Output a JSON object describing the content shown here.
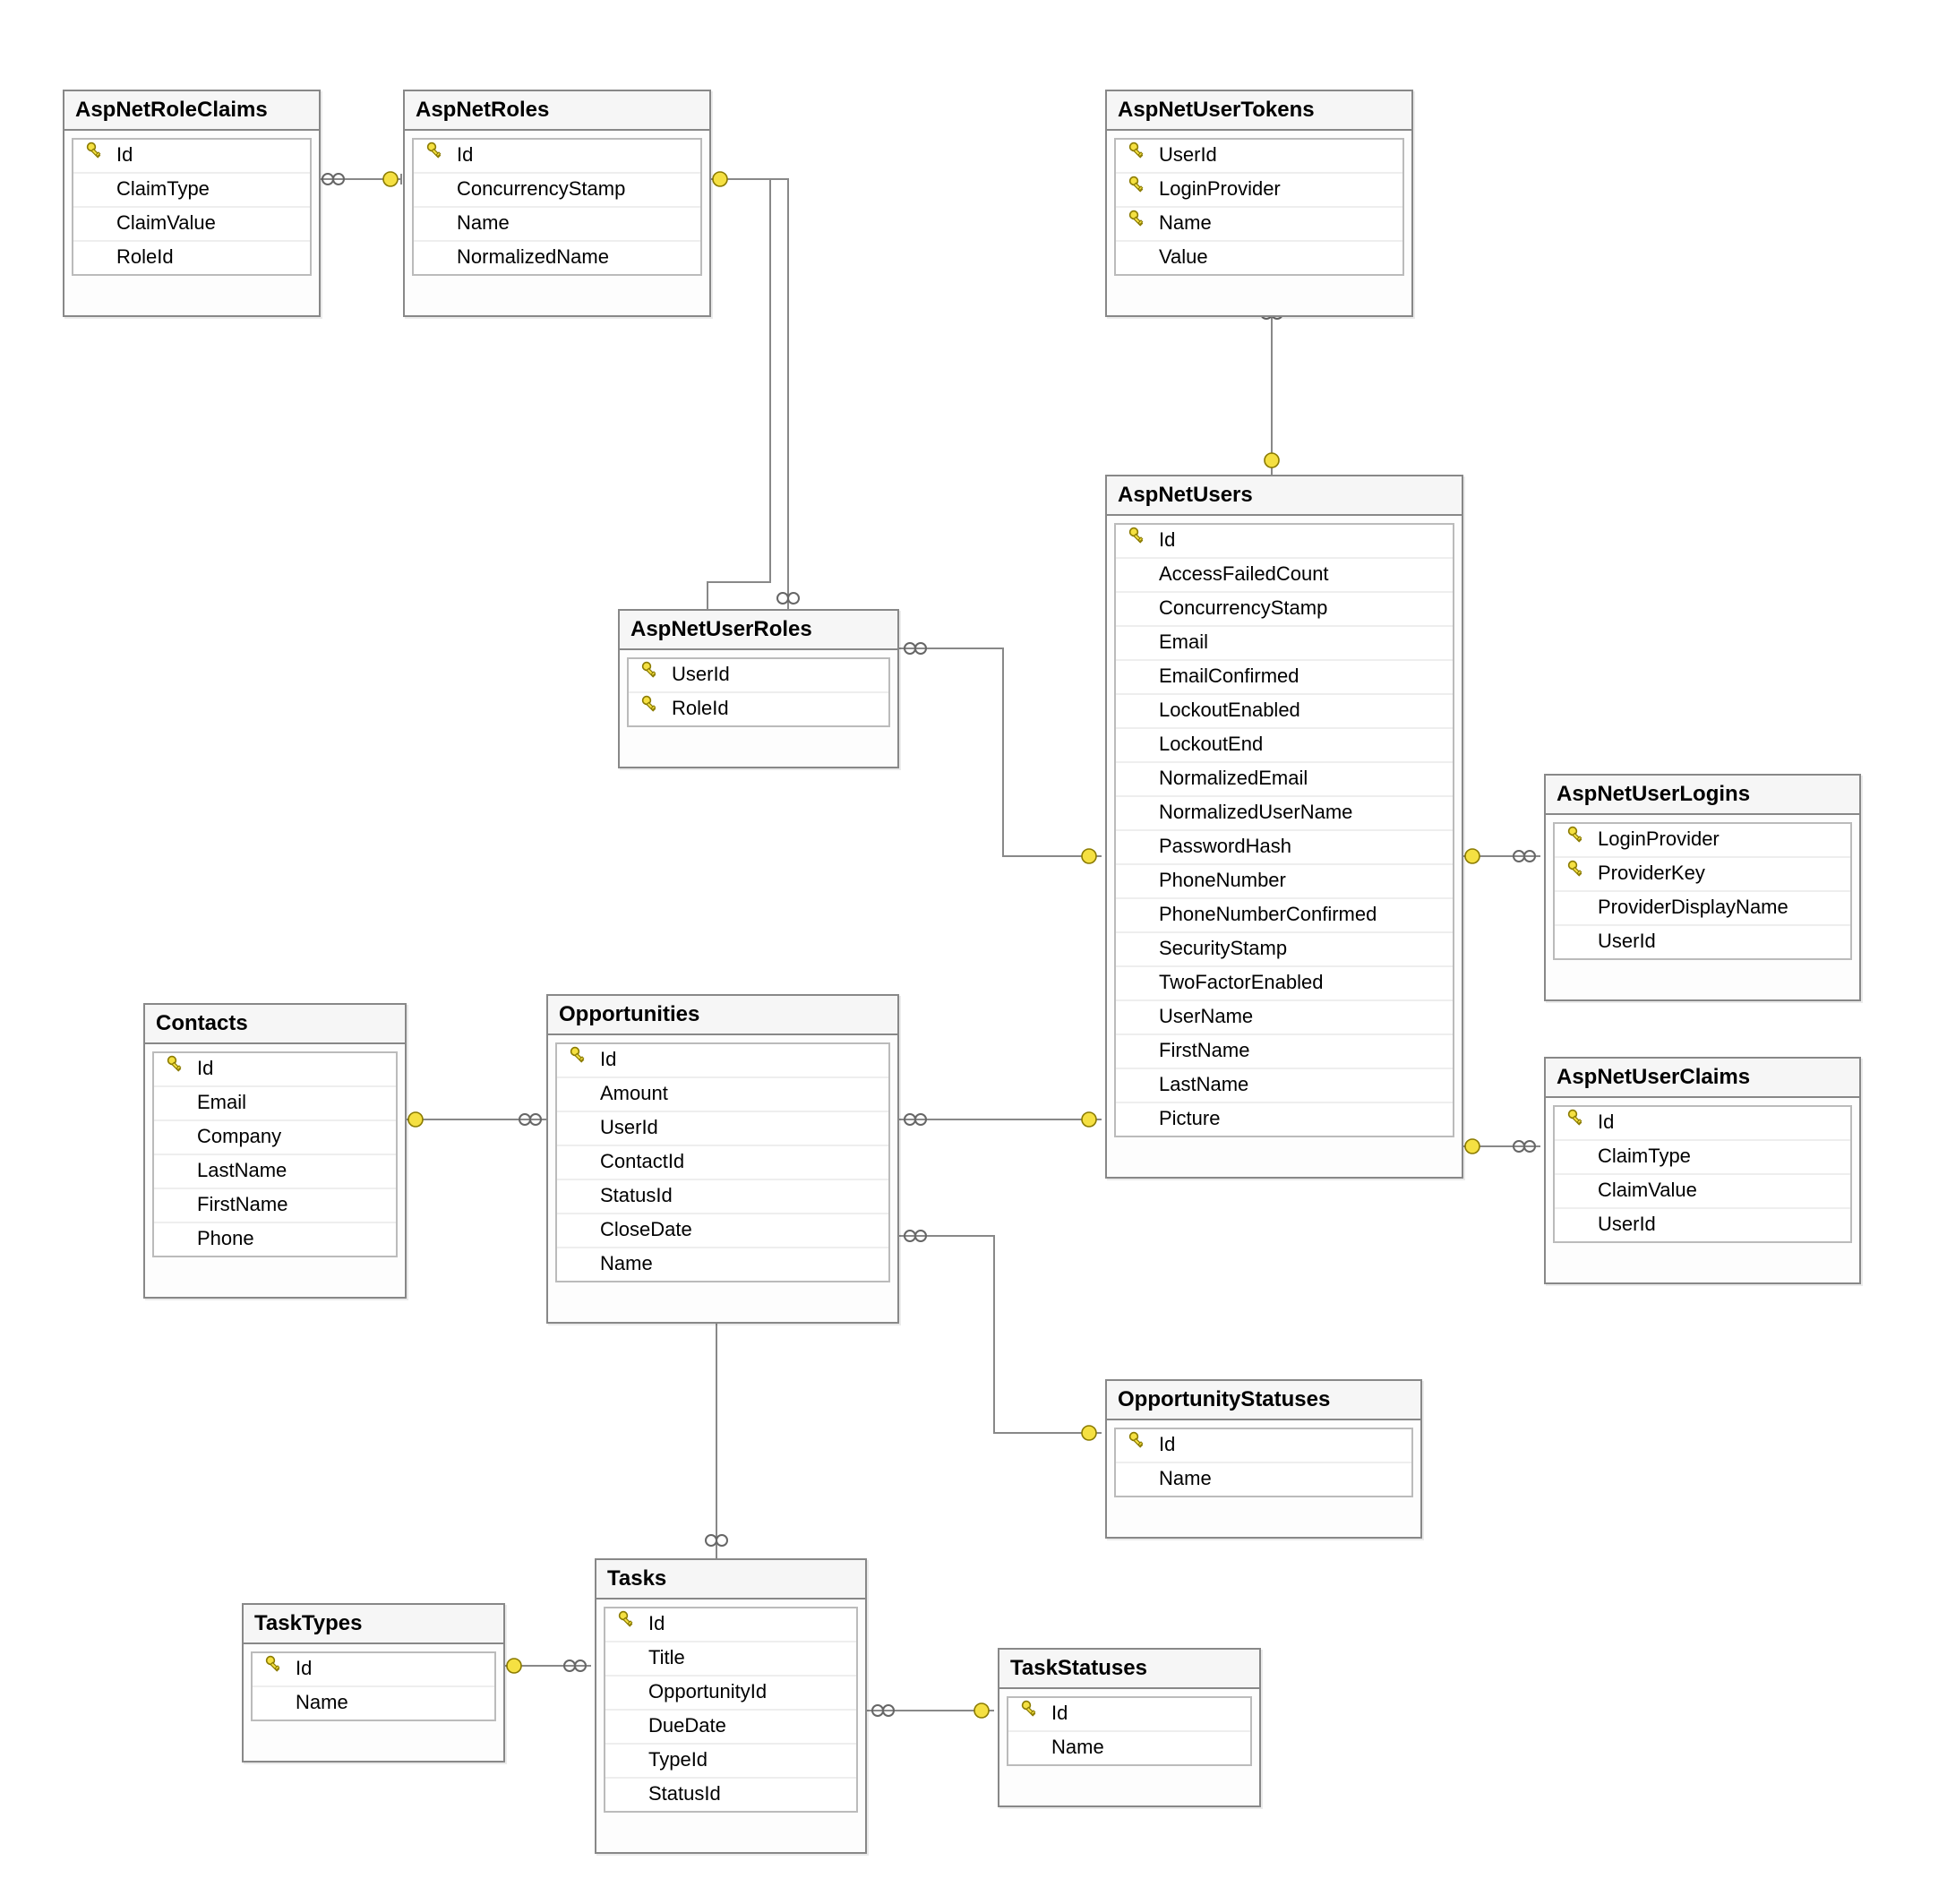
{
  "entities": {
    "aspNetRoleClaims": {
      "title": "AspNetRoleClaims",
      "columns": [
        {
          "name": "Id",
          "key": true
        },
        {
          "name": "ClaimType",
          "key": false
        },
        {
          "name": "ClaimValue",
          "key": false
        },
        {
          "name": "RoleId",
          "key": false
        }
      ]
    },
    "aspNetRoles": {
      "title": "AspNetRoles",
      "columns": [
        {
          "name": "Id",
          "key": true
        },
        {
          "name": "ConcurrencyStamp",
          "key": false
        },
        {
          "name": "Name",
          "key": false
        },
        {
          "name": "NormalizedName",
          "key": false
        }
      ]
    },
    "aspNetUserTokens": {
      "title": "AspNetUserTokens",
      "columns": [
        {
          "name": "UserId",
          "key": true
        },
        {
          "name": "LoginProvider",
          "key": true
        },
        {
          "name": "Name",
          "key": true
        },
        {
          "name": "Value",
          "key": false
        }
      ]
    },
    "aspNetUserRoles": {
      "title": "AspNetUserRoles",
      "columns": [
        {
          "name": "UserId",
          "key": true
        },
        {
          "name": "RoleId",
          "key": true
        }
      ]
    },
    "aspNetUsers": {
      "title": "AspNetUsers",
      "columns": [
        {
          "name": "Id",
          "key": true
        },
        {
          "name": "AccessFailedCount",
          "key": false
        },
        {
          "name": "ConcurrencyStamp",
          "key": false
        },
        {
          "name": "Email",
          "key": false
        },
        {
          "name": "EmailConfirmed",
          "key": false
        },
        {
          "name": "LockoutEnabled",
          "key": false
        },
        {
          "name": "LockoutEnd",
          "key": false
        },
        {
          "name": "NormalizedEmail",
          "key": false
        },
        {
          "name": "NormalizedUserName",
          "key": false
        },
        {
          "name": "PasswordHash",
          "key": false
        },
        {
          "name": "PhoneNumber",
          "key": false
        },
        {
          "name": "PhoneNumberConfirmed",
          "key": false
        },
        {
          "name": "SecurityStamp",
          "key": false
        },
        {
          "name": "TwoFactorEnabled",
          "key": false
        },
        {
          "name": "UserName",
          "key": false
        },
        {
          "name": "FirstName",
          "key": false
        },
        {
          "name": "LastName",
          "key": false
        },
        {
          "name": "Picture",
          "key": false
        }
      ]
    },
    "aspNetUserLogins": {
      "title": "AspNetUserLogins",
      "columns": [
        {
          "name": "LoginProvider",
          "key": true
        },
        {
          "name": "ProviderKey",
          "key": true
        },
        {
          "name": "ProviderDisplayName",
          "key": false
        },
        {
          "name": "UserId",
          "key": false
        }
      ]
    },
    "contacts": {
      "title": "Contacts",
      "columns": [
        {
          "name": "Id",
          "key": true
        },
        {
          "name": "Email",
          "key": false
        },
        {
          "name": "Company",
          "key": false
        },
        {
          "name": "LastName",
          "key": false
        },
        {
          "name": "FirstName",
          "key": false
        },
        {
          "name": "Phone",
          "key": false
        }
      ]
    },
    "opportunities": {
      "title": "Opportunities",
      "columns": [
        {
          "name": "Id",
          "key": true
        },
        {
          "name": "Amount",
          "key": false
        },
        {
          "name": "UserId",
          "key": false
        },
        {
          "name": "ContactId",
          "key": false
        },
        {
          "name": "StatusId",
          "key": false
        },
        {
          "name": "CloseDate",
          "key": false
        },
        {
          "name": "Name",
          "key": false
        }
      ]
    },
    "aspNetUserClaims": {
      "title": "AspNetUserClaims",
      "columns": [
        {
          "name": "Id",
          "key": true
        },
        {
          "name": "ClaimType",
          "key": false
        },
        {
          "name": "ClaimValue",
          "key": false
        },
        {
          "name": "UserId",
          "key": false
        }
      ]
    },
    "opportunityStatuses": {
      "title": "OpportunityStatuses",
      "columns": [
        {
          "name": "Id",
          "key": true
        },
        {
          "name": "Name",
          "key": false
        }
      ]
    },
    "taskTypes": {
      "title": "TaskTypes",
      "columns": [
        {
          "name": "Id",
          "key": true
        },
        {
          "name": "Name",
          "key": false
        }
      ]
    },
    "tasks": {
      "title": "Tasks",
      "columns": [
        {
          "name": "Id",
          "key": true
        },
        {
          "name": "Title",
          "key": false
        },
        {
          "name": "OpportunityId",
          "key": false
        },
        {
          "name": "DueDate",
          "key": false
        },
        {
          "name": "TypeId",
          "key": false
        },
        {
          "name": "StatusId",
          "key": false
        }
      ]
    },
    "taskStatuses": {
      "title": "TaskStatuses",
      "columns": [
        {
          "name": "Id",
          "key": true
        },
        {
          "name": "Name",
          "key": false
        }
      ]
    }
  },
  "relationships": [
    {
      "from": "aspNetRoleClaims",
      "to": "aspNetRoles",
      "many": "aspNetRoleClaims"
    },
    {
      "from": "aspNetRoles",
      "to": "aspNetUserRoles",
      "many": "aspNetUserRoles"
    },
    {
      "from": "aspNetUserTokens",
      "to": "aspNetUsers",
      "many": "aspNetUserTokens"
    },
    {
      "from": "aspNetUserRoles",
      "to": "aspNetUsers",
      "many": "aspNetUserRoles"
    },
    {
      "from": "aspNetUserLogins",
      "to": "aspNetUsers",
      "many": "aspNetUserLogins"
    },
    {
      "from": "aspNetUserClaims",
      "to": "aspNetUsers",
      "many": "aspNetUserClaims"
    },
    {
      "from": "opportunities",
      "to": "aspNetUsers",
      "many": "opportunities"
    },
    {
      "from": "opportunities",
      "to": "contacts",
      "many": "opportunities"
    },
    {
      "from": "opportunities",
      "to": "opportunityStatuses",
      "many": "opportunities"
    },
    {
      "from": "tasks",
      "to": "opportunities",
      "many": "tasks"
    },
    {
      "from": "tasks",
      "to": "taskTypes",
      "many": "tasks"
    },
    {
      "from": "tasks",
      "to": "taskStatuses",
      "many": "tasks"
    }
  ]
}
